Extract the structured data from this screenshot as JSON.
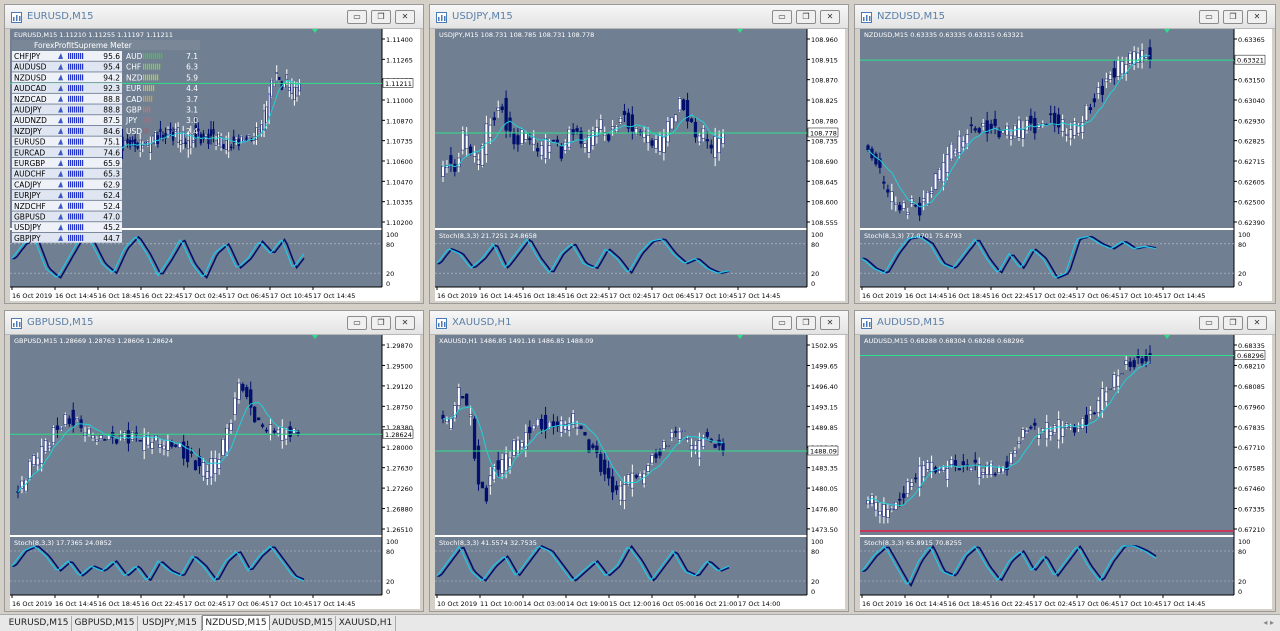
{
  "colors": {
    "chart_bg": "#6f7d8f",
    "plot_bg": "#717f92",
    "candle": "#000f6e",
    "candle_up": "#ffffff",
    "ma": "#1fd0d8",
    "level": "#2be08a",
    "stoch": "#1ec8e6",
    "axis_text": "#ffffff",
    "red_level": "#e0204a"
  },
  "windows": [
    {
      "title": "EURUSD,M15",
      "info": "EURUSD,M15  1.11210 1.11255 1.11197 1.11211",
      "yticks": [
        "1.11400",
        "1.11265",
        "1.11135",
        "1.11000",
        "1.10870",
        "1.10735",
        "1.10600",
        "1.10470",
        "1.10335",
        "1.10200"
      ],
      "price_label": "1.11211",
      "stoch_label": "Stoch(8,3,3) 61.3365 52.4261",
      "stoch_ticks": [
        "100",
        "80",
        "20",
        "0"
      ],
      "xticks": [
        "16 Oct 2019",
        "16 Oct 14:45",
        "16 Oct 18:45",
        "16 Oct 22:45",
        "17 Oct 02:45",
        "17 Oct 06:45",
        "17 Oct 10:45",
        "17 Oct 14:45"
      ],
      "meter": {
        "title": "ForexProfitSupreme Meter",
        "pairs": [
          {
            "name": "CHFJPY",
            "value": "95.6"
          },
          {
            "name": "AUDUSD",
            "value": "95.4"
          },
          {
            "name": "NZDUSD",
            "value": "94.2"
          },
          {
            "name": "AUDCAD",
            "value": "92.3"
          },
          {
            "name": "NZDCAD",
            "value": "88.8"
          },
          {
            "name": "AUDJPY",
            "value": "88.8"
          },
          {
            "name": "AUDNZD",
            "value": "87.5"
          },
          {
            "name": "NZDJPY",
            "value": "84.6"
          },
          {
            "name": "EURUSD",
            "value": "75.1"
          },
          {
            "name": "EURCAD",
            "value": "74.6"
          },
          {
            "name": "EURGBP",
            "value": "65.9"
          },
          {
            "name": "AUDCHF",
            "value": "65.3"
          },
          {
            "name": "CADJPY",
            "value": "62.9"
          },
          {
            "name": "EURJPY",
            "value": "62.4"
          },
          {
            "name": "NZDCHF",
            "value": "52.4"
          },
          {
            "name": "GBPUSD",
            "value": "47.0"
          },
          {
            "name": "USDJPY",
            "value": "45.2"
          },
          {
            "name": "GBPJPY",
            "value": "44.7"
          }
        ],
        "currencies": [
          {
            "name": "AUD",
            "value": "7.1"
          },
          {
            "name": "CHF",
            "value": "6.3"
          },
          {
            "name": "NZD",
            "value": "5.9"
          },
          {
            "name": "EUR",
            "value": "4.4"
          },
          {
            "name": "CAD",
            "value": "3.7"
          },
          {
            "name": "GBP",
            "value": "3.1"
          },
          {
            "name": "JPY",
            "value": "3.0"
          },
          {
            "name": "USD",
            "value": "2.4"
          }
        ]
      }
    },
    {
      "title": "USDJPY,M15",
      "info": "USDJPY,M15  108.731 108.785 108.731 108.778",
      "yticks": [
        "108.960",
        "108.915",
        "108.870",
        "108.825",
        "108.780",
        "108.735",
        "108.690",
        "108.645",
        "108.600",
        "108.555"
      ],
      "price_label": "108.778",
      "stoch_label": "Stoch(8,3,3) 21.7251 24.8658",
      "stoch_ticks": [
        "100",
        "80",
        "20",
        "0"
      ],
      "xticks": [
        "16 Oct 2019",
        "16 Oct 14:45",
        "16 Oct 18:45",
        "16 Oct 22:45",
        "17 Oct 02:45",
        "17 Oct 06:45",
        "17 Oct 10:45",
        "17 Oct 14:45"
      ]
    },
    {
      "title": "NZDUSD,M15",
      "info": "NZDUSD,M15  0.63335 0.63335 0.63315 0.63321",
      "yticks": [
        "0.63365",
        "0.63255",
        "0.63150",
        "0.63040",
        "0.62930",
        "0.62825",
        "0.62715",
        "0.62605",
        "0.62500",
        "0.62390"
      ],
      "price_label": "0.63321",
      "stoch_label": "Stoch(8,3,3) 77.0701 75.6793",
      "stoch_ticks": [
        "100",
        "80",
        "20",
        "0"
      ],
      "xticks": [
        "16 Oct 2019",
        "16 Oct 14:45",
        "16 Oct 18:45",
        "16 Oct 22:45",
        "17 Oct 02:45",
        "17 Oct 06:45",
        "17 Oct 10:45",
        "17 Oct 14:45"
      ]
    },
    {
      "title": "GBPUSD,M15",
      "info": "GBPUSD,M15  1.28669 1.28763 1.28606 1.28624",
      "yticks": [
        "1.29870",
        "1.29500",
        "1.29120",
        "1.28750",
        "1.28380",
        "1.28000",
        "1.27630",
        "1.27260",
        "1.26880",
        "1.26510"
      ],
      "price_label": "1.28624",
      "stoch_label": "Stoch(8,3,3) 17.7365 24.0852",
      "stoch_ticks": [
        "100",
        "80",
        "20",
        "0"
      ],
      "xticks": [
        "16 Oct 2019",
        "16 Oct 14:45",
        "16 Oct 18:45",
        "16 Oct 22:45",
        "17 Oct 02:45",
        "17 Oct 06:45",
        "17 Oct 10:45",
        "17 Oct 14:45"
      ]
    },
    {
      "title": "XAUUSD,H1",
      "info": "XAUUSD,H1  1486.85 1491.16 1486.85 1488.09",
      "yticks": [
        "1502.95",
        "1499.65",
        "1496.40",
        "1493.15",
        "1489.85",
        "1486.60",
        "1483.35",
        "1480.05",
        "1476.80",
        "1473.50"
      ],
      "price_label": "1488.09",
      "stoch_label": "Stoch(8,3,3) 41.5574 32.7535",
      "stoch_ticks": [
        "100",
        "80",
        "20",
        "0"
      ],
      "xticks": [
        "10 Oct 2019",
        "11 Oct 10:00",
        "14 Oct 03:00",
        "14 Oct 19:00",
        "15 Oct 12:00",
        "16 Oct 05:00",
        "16 Oct 21:00",
        "17 Oct 14:00"
      ]
    },
    {
      "title": "AUDUSD,M15",
      "info": "AUDUSD,M15  0.68288 0.68304 0.68268 0.68296",
      "yticks": [
        "0.68335",
        "0.68210",
        "0.68085",
        "0.67960",
        "0.67835",
        "0.67710",
        "0.67585",
        "0.67460",
        "0.67335",
        "0.67210"
      ],
      "price_label": "0.68296",
      "stoch_label": "Stoch(8,3,3) 65.8915 70.8255",
      "stoch_ticks": [
        "100",
        "80",
        "20",
        "0"
      ],
      "xticks": [
        "16 Oct 2019",
        "16 Oct 14:45",
        "16 Oct 18:45",
        "16 Oct 22:45",
        "17 Oct 02:45",
        "17 Oct 06:45",
        "17 Oct 10:45",
        "17 Oct 14:45"
      ]
    }
  ],
  "tabs": [
    {
      "label": "EURUSD,M15",
      "active": false
    },
    {
      "label": "GBPUSD,M15",
      "active": false
    },
    {
      "label": "USDJPY,M15",
      "active": false
    },
    {
      "label": "NZDUSD,M15",
      "active": true
    },
    {
      "label": "AUDUSD,M15",
      "active": false
    },
    {
      "label": "XAUUSD,H1",
      "active": false
    }
  ],
  "window_buttons": {
    "minimize": "▭",
    "restore": "❐",
    "close": "✕"
  },
  "tab_scroll": "◂ ▸"
}
